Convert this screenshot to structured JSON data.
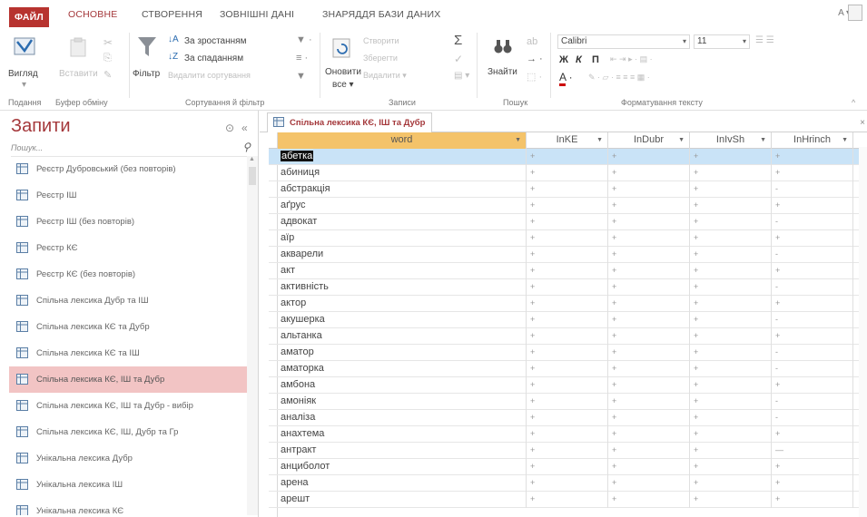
{
  "tabs": {
    "file": "ФАЙЛ",
    "home": "ОСНОВНЕ",
    "create": "СТВОРЕННЯ",
    "external": "ЗОВНІШНІ ДАНІ",
    "tools": "ЗНАРЯДДЯ БАЗИ ДАНИХ",
    "account": "A ▾"
  },
  "ribbon": {
    "view_label": "Вигляд",
    "paste_label": "Вставити",
    "filter_label": "Фільтр",
    "sort_asc": "За зростанням",
    "sort_desc": "За спаданням",
    "remove_sort": "Видалити сортування",
    "refresh_label": "Оновити",
    "refresh_all": "все ▾",
    "new_label": "Створити",
    "save_label": "Зберегти",
    "delete_label": "Видалити ▾",
    "find_label": "Знайти",
    "font_name": "Calibri",
    "font_size": "11",
    "bold": "Ж",
    "italic": "К",
    "underline": "П",
    "groups": {
      "views": "Подання",
      "clipboard": "Буфер обміну",
      "sort_filter": "Сортування й фільтр",
      "records": "Записи",
      "find": "Пошук",
      "text_format": "Форматування тексту"
    }
  },
  "nav": {
    "title": "Запити",
    "search_placeholder": "Пошук...",
    "items": [
      {
        "label": "Реєстр Дубровський (без повторів)"
      },
      {
        "label": "Реєстр ІШ"
      },
      {
        "label": "Реєстр ІШ (без повторів)"
      },
      {
        "label": "Реєстр КЄ"
      },
      {
        "label": "Реєстр КЄ (без повторів)"
      },
      {
        "label": "Спільна лексика Дубр та ІШ"
      },
      {
        "label": "Спільна лексика КЄ та Дубр"
      },
      {
        "label": "Спільна лексика КЄ та ІШ"
      },
      {
        "label": "Спільна лексика КЄ, ІШ та Дубр",
        "selected": true
      },
      {
        "label": "Спільна лексика КЄ, ІШ та Дубр - вибір"
      },
      {
        "label": "Спільна лексика КЄ, ІШ, Дубр та Гр"
      },
      {
        "label": "Унікальна лексика Дубр"
      },
      {
        "label": "Унікальна лексика ІШ"
      },
      {
        "label": "Унікальна лексика КЄ"
      }
    ]
  },
  "document": {
    "tab_title": "Спільна лексика КЄ, ІШ та Дубр",
    "columns": [
      "word",
      "InKE",
      "InDubr",
      "InIvSh",
      "InHrinch"
    ],
    "rows": [
      [
        "абетка",
        "+",
        "+",
        "+",
        "+"
      ],
      [
        "абиниця",
        "+",
        "+",
        "+",
        "+"
      ],
      [
        "абстракція",
        "+",
        "+",
        "+",
        "-"
      ],
      [
        "аґрус",
        "+",
        "+",
        "+",
        "+"
      ],
      [
        "адвокат",
        "+",
        "+",
        "+",
        "-"
      ],
      [
        "аїр",
        "+",
        "+",
        "+",
        "+"
      ],
      [
        "акварели",
        "+",
        "+",
        "+",
        "-"
      ],
      [
        "акт",
        "+",
        "+",
        "+",
        "+"
      ],
      [
        "активність",
        "+",
        "+",
        "+",
        "-"
      ],
      [
        "актор",
        "+",
        "+",
        "+",
        "+"
      ],
      [
        "акушерка",
        "+",
        "+",
        "+",
        "-"
      ],
      [
        "альтанка",
        "+",
        "+",
        "+",
        "+"
      ],
      [
        "аматор",
        "+",
        "+",
        "+",
        "-"
      ],
      [
        "аматорка",
        "+",
        "+",
        "+",
        "-"
      ],
      [
        "амбона",
        "+",
        "+",
        "+",
        "+"
      ],
      [
        "амоніяк",
        "+",
        "+",
        "+",
        "-"
      ],
      [
        "аналіза",
        "+",
        "+",
        "+",
        "-"
      ],
      [
        "анахтема",
        "+",
        "+",
        "+",
        "+"
      ],
      [
        "антракт",
        "+",
        "+",
        "+",
        "—"
      ],
      [
        "анциболот",
        "+",
        "+",
        "+",
        "+"
      ],
      [
        "арена",
        "+",
        "+",
        "+",
        "+"
      ],
      [
        "арешт",
        "+",
        "+",
        "+",
        "+"
      ]
    ]
  },
  "colors": {
    "accent": "#a4373a",
    "file_tab": "#b7332f",
    "selected_nav": "#f2c4c4",
    "word_header": "#f4c36a",
    "selected_row": "#c9e3f7"
  }
}
